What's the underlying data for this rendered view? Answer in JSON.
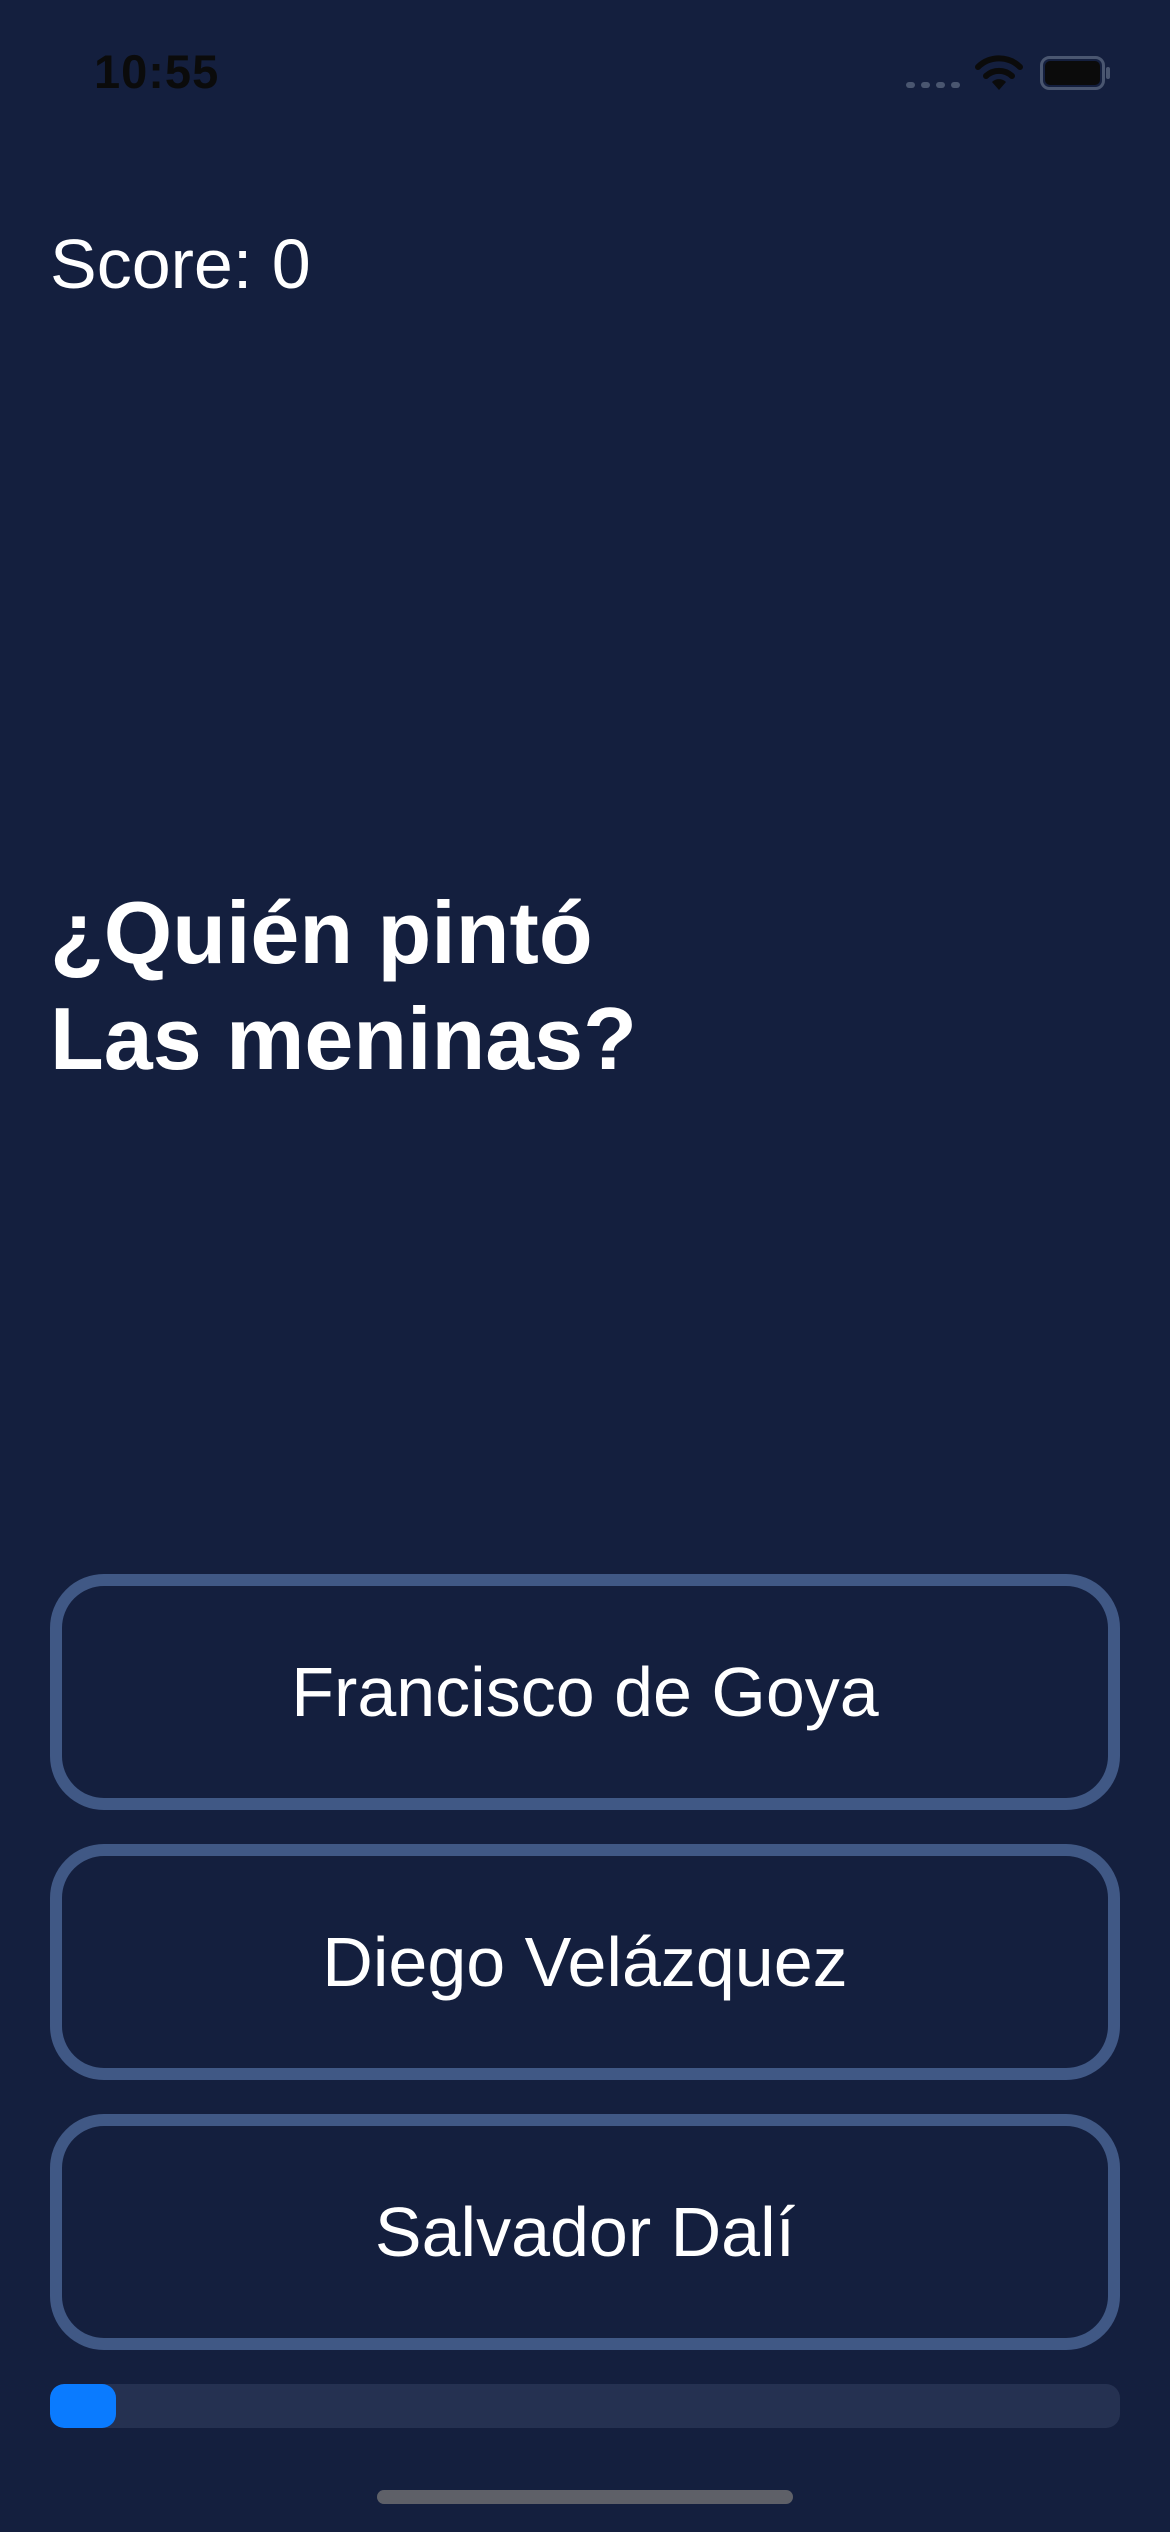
{
  "status_bar": {
    "time": "10:55",
    "icons": [
      "cellular-signal-icon",
      "wifi-icon",
      "battery-icon"
    ]
  },
  "score": {
    "text": "Score: 0"
  },
  "question": {
    "line1": "¿Quién pintó",
    "line2": "Las meninas?"
  },
  "answers": [
    {
      "label": "Francisco de Goya"
    },
    {
      "label": "Diego Velázquez"
    },
    {
      "label": "Salvador Dalí"
    }
  ],
  "progress": {
    "fraction": 0.062
  },
  "colors": {
    "background": "#141F3E",
    "button_border": "#405885",
    "progress_track": "#253151",
    "progress_fill": "#0A7BFF"
  }
}
